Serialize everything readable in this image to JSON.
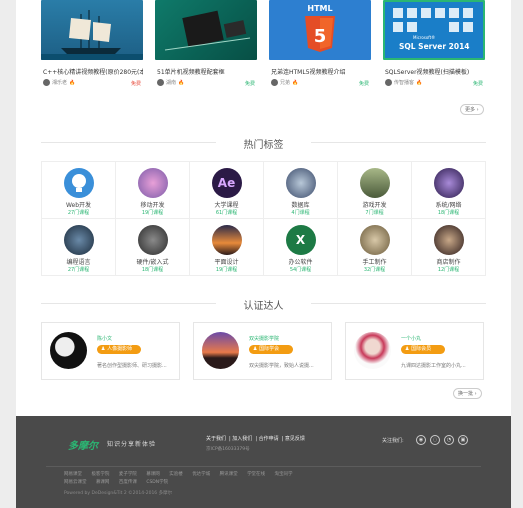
{
  "courses": [
    {
      "title": "C++核心精讲视频教程(原价280元(本",
      "author": "湘乐老",
      "price": "免费",
      "price_type": "paid"
    },
    {
      "title": "51单片机视频教程配套框",
      "author": "湖南",
      "price": "免费",
      "price_type": "free"
    },
    {
      "title": "兄弟连HTML5视频教程介绍",
      "author": "兄弟",
      "price": "免费",
      "price_type": "free"
    },
    {
      "title": "SQLServer视频教程(扫描模板)",
      "author": "传智播客",
      "price": "免费",
      "price_type": "free"
    }
  ],
  "thumb_text": {
    "html": "HTML",
    "sql_brand": "SQL Server 2014",
    "sql_logo": "Microsoft®"
  },
  "more_label": "更多 ›",
  "hot_tags_title": "热门标签",
  "tags": [
    {
      "name": "Web开发",
      "count": "27门课程",
      "icon": "web-icon",
      "color": "#3a8fd9"
    },
    {
      "name": "移动开发",
      "count": "19门课程",
      "icon": "mobile-icon",
      "color": "#c070b8"
    },
    {
      "name": "大学课程",
      "count": "61门课程",
      "icon": "ae-icon",
      "color": "#2b1a46",
      "glyph": "Ae"
    },
    {
      "name": "数据库",
      "count": "4门课程",
      "icon": "database-icon",
      "color": "#5a6f8a"
    },
    {
      "name": "游戏开发",
      "count": "7门课程",
      "icon": "game-icon",
      "color": "#7a8a5a"
    },
    {
      "name": "系统/网络",
      "count": "18门课程",
      "icon": "network-icon",
      "color": "#3a2a5a"
    },
    {
      "name": "编程语言",
      "count": "27门课程",
      "icon": "code-icon",
      "color": "#2a3a4a"
    },
    {
      "name": "硬件/嵌入式",
      "count": "18门课程",
      "icon": "hardware-icon",
      "color": "#3a3a3a"
    },
    {
      "name": "平面设计",
      "count": "19门课程",
      "icon": "design-icon",
      "color": "#c06a2a"
    },
    {
      "name": "办公软件",
      "count": "54门课程",
      "icon": "excel-icon",
      "color": "#1d7a45",
      "glyph": "X"
    },
    {
      "name": "手工制作",
      "count": "32门课程",
      "icon": "handmade-icon",
      "color": "#9a8a6a"
    },
    {
      "name": "商店制作",
      "count": "12门课程",
      "icon": "shop-icon",
      "color": "#4a3a3a"
    }
  ],
  "experts_title": "认证达人",
  "experts": [
    {
      "name": "陈小文",
      "badge": "♟ 人像摄影师",
      "desc": "著名创作型摄影师、研习摄影..."
    },
    {
      "name": "双尖摄影学院",
      "badge": "♟ 国际学会",
      "desc": "双尖摄影学院，致始人说摄..."
    },
    {
      "name": "一个小丸",
      "badge": "♟ 国际会员",
      "desc": "九课四达摄影工作室的小丸..."
    }
  ],
  "experts_more": "换一批 ›",
  "footer": {
    "logo": "多摩尔",
    "logo_sub": "知识分享新体验",
    "links": [
      "关于我们",
      "加入我们",
      "合作申请",
      "意见反馈"
    ],
    "icp": "京ICP备16033379号",
    "follow": "关注我们:",
    "social_icons": [
      "weibo-icon",
      "wechat-icon",
      "qq-icon",
      "app-icon"
    ],
    "friend_links": [
      "网易课堂",
      "极客学院",
      "麦子学院",
      "慕课网",
      "实验楼",
      "优达学城",
      "腾讯课堂",
      "学堂在线",
      "淘宝同学"
    ],
    "friend_links2": [
      "网易云课堂",
      "慕课网",
      "百度传课",
      "CSDN学院"
    ],
    "copyright": "Powered by DeDesign&Tit 2 ©2014-2016 多摩尔"
  }
}
